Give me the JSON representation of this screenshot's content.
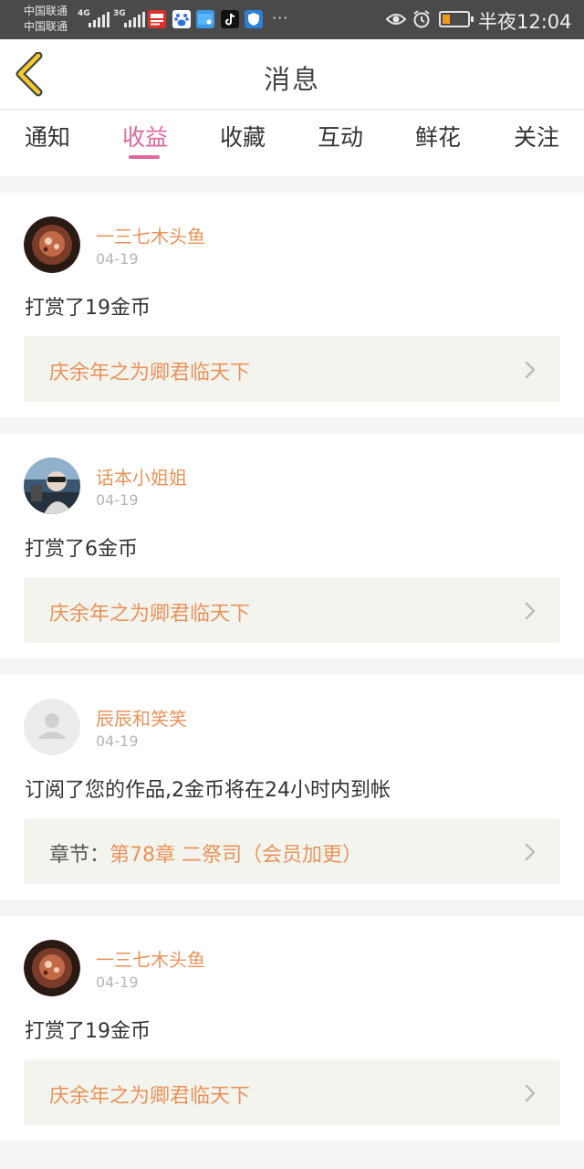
{
  "status_bar": {
    "carrier_1": "中国联通",
    "carrier_2": "中国联通",
    "net_1": "4G",
    "net_2": "3G",
    "time": "半夜12:04",
    "app_icons": [
      "toutiao-icon",
      "baidu-icon",
      "mail-icon",
      "tiktok-icon",
      "shield-app-icon"
    ],
    "battery_color": "#f29b1d"
  },
  "header": {
    "title": "消息"
  },
  "tabs": [
    {
      "label": "通知",
      "active": false
    },
    {
      "label": "收益",
      "active": true
    },
    {
      "label": "收藏",
      "active": false
    },
    {
      "label": "互动",
      "active": false
    },
    {
      "label": "鲜花",
      "active": false
    },
    {
      "label": "关注",
      "active": false
    }
  ],
  "colors": {
    "accent": "#e0669c",
    "username": "#e9935a",
    "link": "#e9935a"
  },
  "messages": [
    {
      "username": "一三七木头鱼",
      "date": "04-19",
      "text": "打赏了19金币",
      "link": {
        "prefix": "",
        "title": "庆余年之为卿君临天下"
      }
    },
    {
      "username": "话本小姐姐",
      "date": "04-19",
      "text": "打赏了6金币",
      "link": {
        "prefix": "",
        "title": "庆余年之为卿君临天下"
      }
    },
    {
      "username": "辰辰和笑笑",
      "date": "04-19",
      "text": "订阅了您的作品,2金币将在24小时内到帐",
      "link": {
        "prefix": "章节：",
        "title": "第78章 二祭司（会员加更）"
      }
    },
    {
      "username": "一三七木头鱼",
      "date": "04-19",
      "text": "打赏了19金币",
      "link": {
        "prefix": "",
        "title": "庆余年之为卿君临天下"
      }
    }
  ]
}
